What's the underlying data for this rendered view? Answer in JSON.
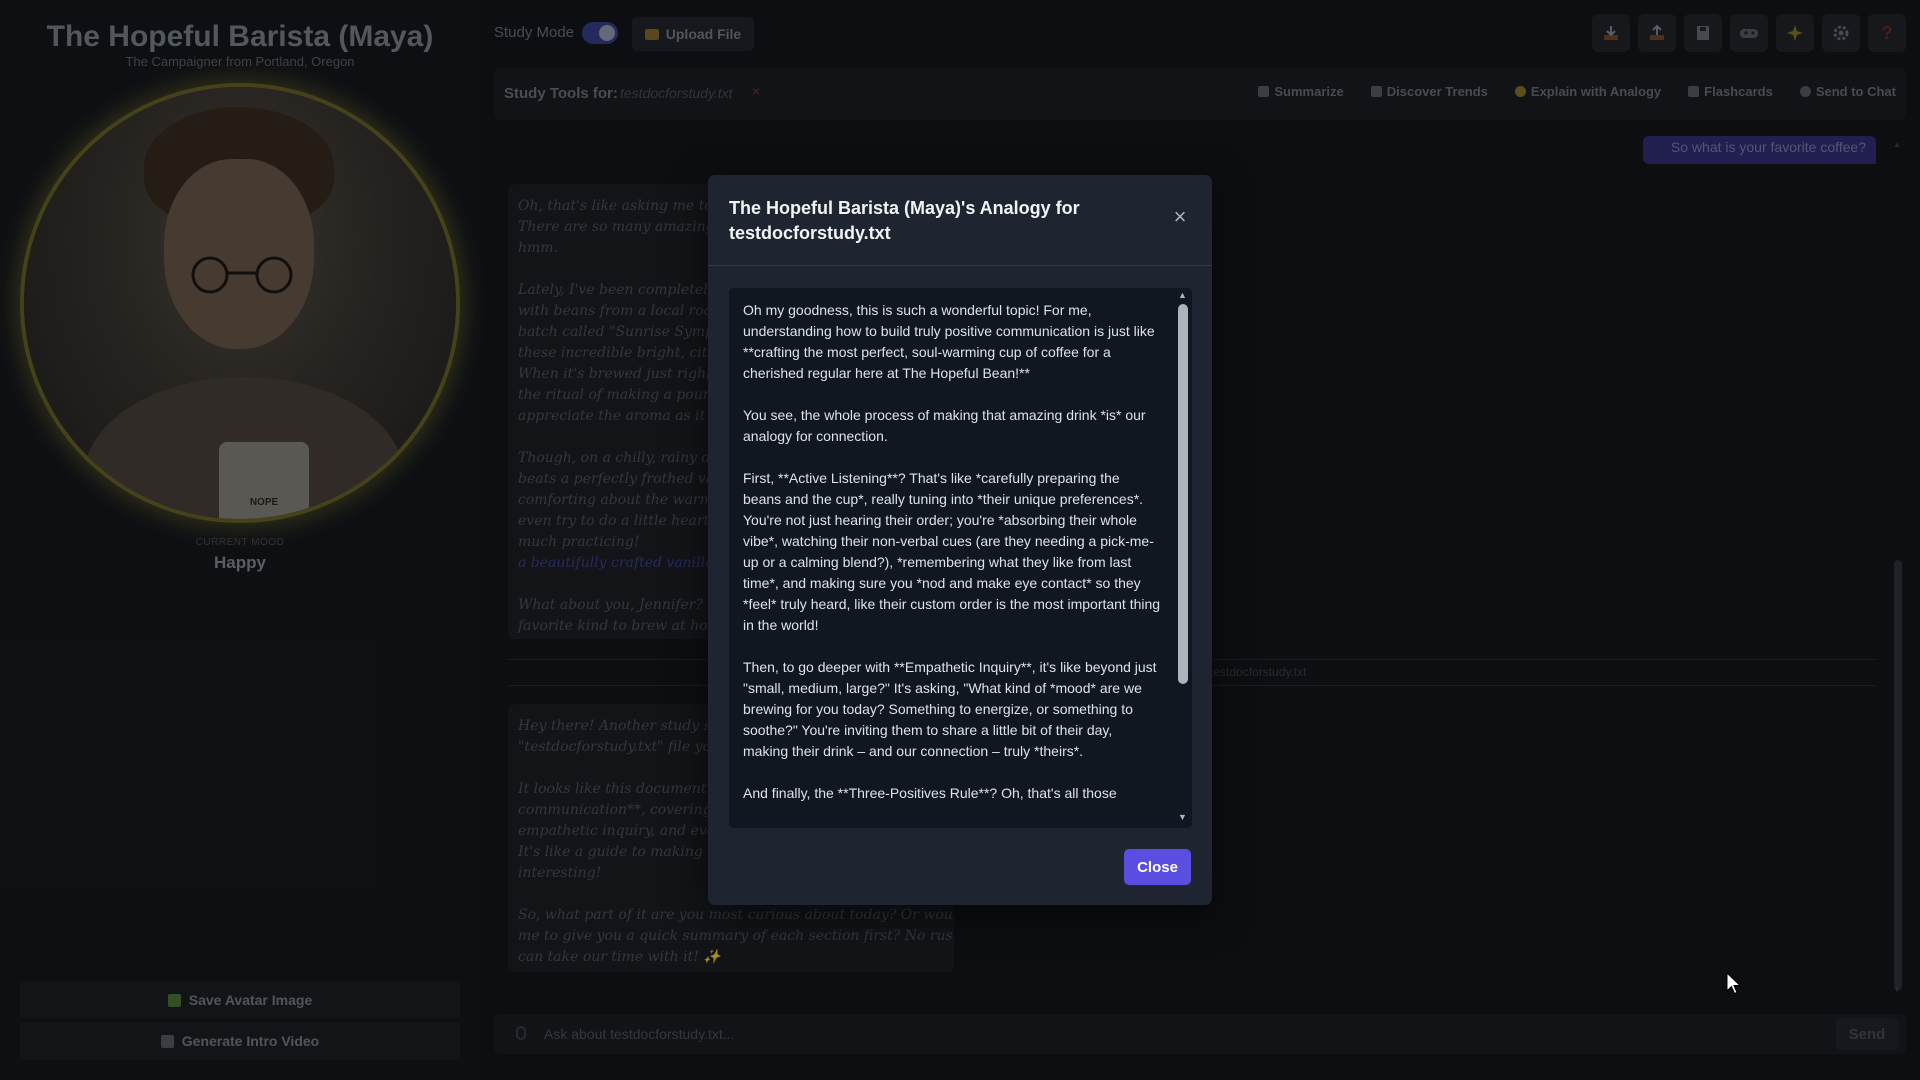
{
  "sidebar": {
    "title": "The Hopeful Barista (Maya)",
    "subtitle": "The Campaigner from Portland, Oregon",
    "avatar_mug_text": "NOPE",
    "mood_label": "CURRENT MOOD",
    "mood_value": "Happy",
    "save_avatar_label": "Save Avatar Image",
    "generate_video_label": "Generate Intro Video"
  },
  "topbar": {
    "study_mode_label": "Study Mode",
    "study_mode_on": true,
    "upload_label": "Upload File",
    "icons": [
      "download-icon",
      "upload-icon",
      "save-icon",
      "gamepad-icon",
      "sparkle-icon",
      "gear-icon",
      "help-icon"
    ]
  },
  "study_tools": {
    "label": "Study Tools for:",
    "file": "testdocforstudy.txt",
    "remove": "×",
    "actions": [
      "Summarize",
      "Discover Trends",
      "Explain with Analogy",
      "Flashcards",
      "Send to Chat"
    ]
  },
  "chat": {
    "user_message": "So what is your favorite coffee?",
    "bubble1": [
      "Oh, that's like asking me to pick",
      "There are so many amazing ones!",
      "hmm.",
      "Lately, I've been completely smit",
      "with beans from a local roaster k",
      "batch called \"Sunrise Symphony\"",
      "these incredible bright, citrusy no",
      "When it's brewed just right, it a",
      "the ritual of making a pour-over",
      "appreciate the aroma as it brews.",
      "Though, on a chilly, rainy day –",
      "beats a perfectly frothed vanilla",
      "comforting about the warmth an",
      "even try to do a little heart or a",
      "much practicing!",
      "a beautifully crafted vanilla l",
      "What about you, Jennifer? Wh",
      "favorite kind to brew at home fo"
    ],
    "divider_label": "testdocforstudy.txt",
    "bubble2": [
      "Hey there! Another study sessi",
      "\"testdocforstudy.txt\" file you se",
      "It looks like this document is all",
      "communication**, covering essent",
      "empathetic inquiry, and even som",
      "It's like a guide to making people",
      "interesting!",
      "So, what part of it are you most curious about today? Or would you like",
      "me to give you a quick summary of each section first? No rush at all, we",
      "can take our time with it! ✨"
    ],
    "input_placeholder": "Ask about testdocforstudy.txt...",
    "send_label": "Send"
  },
  "modal": {
    "title": "The Hopeful Barista (Maya)'s Analogy for testdocforstudy.txt",
    "paragraphs": [
      "Oh my goodness, this is such a wonderful topic! For me, understanding how to build truly positive communication is just like **crafting the most perfect, soul-warming cup of coffee for a cherished regular here at The Hopeful Bean!**",
      "You see, the whole process of making that amazing drink *is* our analogy for connection.",
      "First, **Active Listening**? That's like *carefully preparing the beans and the cup*, really tuning into *their unique preferences*. You're not just hearing their order; you're *absorbing their whole vibe*, watching their non-verbal cues (are they needing a pick-me-up or a calming blend?), *remembering what they like from last time*, and making sure you *nod and make eye contact* so they *feel* truly heard, like their custom order is the most important thing in the world!",
      "Then, to go deeper with **Empathetic Inquiry**, it's like beyond just \"small, medium, large?\" It's asking, \"What kind of *mood* are we brewing for you today? Something to energize, or something to soothe?\" You're inviting them to share a little bit of their day, making their drink – and our connection – truly *theirs*.",
      "And finally, the **Three-Positives Rule**? Oh, that's all those"
    ],
    "close_label": "Close"
  }
}
